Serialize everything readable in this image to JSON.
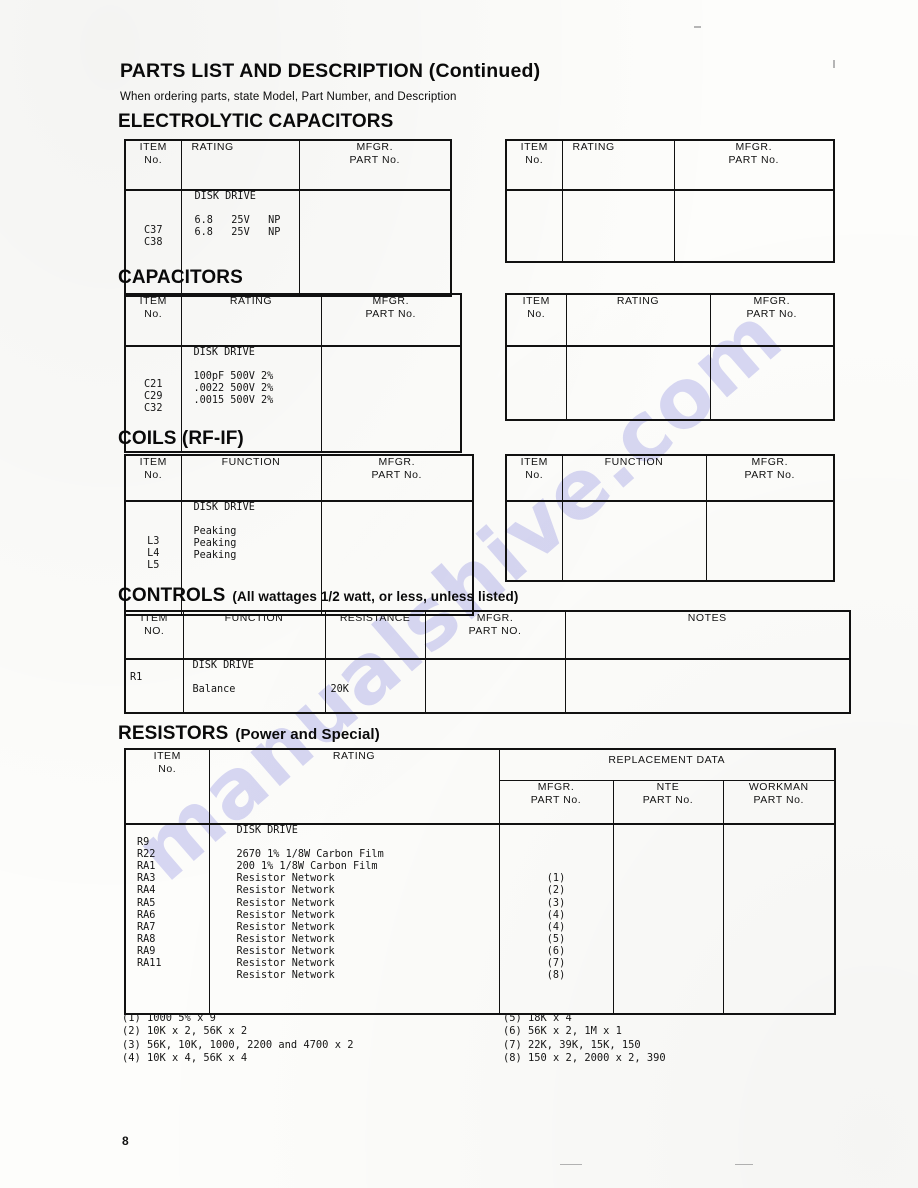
{
  "document": {
    "title": "PARTS LIST AND DESCRIPTION (Continued)",
    "subtitle": "When ordering parts, state Model, Part Number, and Description",
    "page_number": "8",
    "watermark": "manualshive.com"
  },
  "sections": [
    {
      "id": "electrolytic-capacitors",
      "heading": "ELECTROLYTIC CAPACITORS",
      "heading_qualifier": "",
      "left_table": {
        "headers": [
          "ITEM\nNo.",
          "RATING",
          "MFGR.\nPART No."
        ],
        "group_label": "DISK DRIVE",
        "rows": [
          {
            "item": "C37",
            "rating": "6.8   25V   NP",
            "mfgr": ""
          },
          {
            "item": "C38",
            "rating": "6.8   25V   NP",
            "mfgr": ""
          }
        ]
      },
      "right_table": {
        "headers": [
          "ITEM\nNo.",
          "RATING",
          "MFGR.\nPART No."
        ],
        "rows": []
      }
    },
    {
      "id": "capacitors",
      "heading": "CAPACITORS",
      "heading_qualifier": "",
      "left_table": {
        "headers": [
          "ITEM\nNo.",
          "RATING",
          "MFGR.\nPART No."
        ],
        "group_label": "DISK DRIVE",
        "rows": [
          {
            "item": "C21",
            "rating": "100pF 500V 2%",
            "mfgr": ""
          },
          {
            "item": "C29",
            "rating": ".0022 500V 2%",
            "mfgr": ""
          },
          {
            "item": "C32",
            "rating": ".0015 500V 2%",
            "mfgr": ""
          }
        ]
      },
      "right_table": {
        "headers": [
          "ITEM\nNo.",
          "RATING",
          "MFGR.\nPART No."
        ],
        "rows": []
      }
    },
    {
      "id": "coils-rf-if",
      "heading": "COILS (RF-IF)",
      "heading_qualifier": "",
      "left_table": {
        "headers": [
          "ITEM\nNo.",
          "FUNCTION",
          "MFGR.\nPART No."
        ],
        "group_label": "DISK DRIVE",
        "rows": [
          {
            "item": "L3",
            "rating": "Peaking",
            "mfgr": ""
          },
          {
            "item": "L4",
            "rating": "Peaking",
            "mfgr": ""
          },
          {
            "item": "L5",
            "rating": "Peaking",
            "mfgr": ""
          }
        ]
      },
      "right_table": {
        "headers": [
          "ITEM\nNo.",
          "FUNCTION",
          "MFGR.\nPART No."
        ],
        "rows": []
      }
    }
  ],
  "controls": {
    "heading": "CONTROLS",
    "heading_qualifier": "(All wattages 1/2 watt, or less, unless listed)",
    "headers": [
      "ITEM\nNO.",
      "FUNCTION",
      "RESISTANCE",
      "MFGR.\nPART NO.",
      "NOTES"
    ],
    "group_label": "DISK DRIVE",
    "rows": [
      {
        "item": "R1",
        "function": "Balance",
        "resistance": "20K",
        "mfgr": "",
        "notes": ""
      }
    ]
  },
  "resistors": {
    "heading": "RESISTORS",
    "heading_qualifier": "(Power and Special)",
    "group_header": "REPLACEMENT DATA",
    "headers": [
      "ITEM\nNo.",
      "RATING",
      "MFGR.\nPART No.",
      "NTE\nPART No.",
      "WORKMAN\nPART No."
    ],
    "group_label": "DISK DRIVE",
    "rows": [
      {
        "item": "R9",
        "rating": "2670 1% 1/8W Carbon Film",
        "mfgr": "",
        "nte": "",
        "workman": ""
      },
      {
        "item": "R22",
        "rating": "200 1% 1/8W Carbon Film",
        "mfgr": "",
        "nte": "",
        "workman": ""
      },
      {
        "item": "RA1",
        "rating": "Resistor Network",
        "mfgr": "(1)",
        "nte": "",
        "workman": ""
      },
      {
        "item": "RA3",
        "rating": "Resistor Network",
        "mfgr": "(2)",
        "nte": "",
        "workman": ""
      },
      {
        "item": "RA4",
        "rating": "Resistor Network",
        "mfgr": "(3)",
        "nte": "",
        "workman": ""
      },
      {
        "item": "RA5",
        "rating": "Resistor Network",
        "mfgr": "(4)",
        "nte": "",
        "workman": ""
      },
      {
        "item": "RA6",
        "rating": "Resistor Network",
        "mfgr": "(4)",
        "nte": "",
        "workman": ""
      },
      {
        "item": "RA7",
        "rating": "Resistor Network",
        "mfgr": "(5)",
        "nte": "",
        "workman": ""
      },
      {
        "item": "RA8",
        "rating": "Resistor Network",
        "mfgr": "(6)",
        "nte": "",
        "workman": ""
      },
      {
        "item": "RA9",
        "rating": "Resistor Network",
        "mfgr": "(7)",
        "nte": "",
        "workman": ""
      },
      {
        "item": "RA11",
        "rating": "Resistor Network",
        "mfgr": "(8)",
        "nte": "",
        "workman": ""
      }
    ]
  },
  "footnotes": {
    "left": "(1) 1000 5% x 9\n(2) 10K x 2, 56K x 2\n(3) 56K, 10K, 1000, 2200 and 4700 x 2\n(4) 10K x 4, 56K x 4",
    "right": "(5) 18K x 4\n(6) 56K x 2, 1M x 1\n(7) 22K, 39K, 15K, 150\n(8) 150 x 2, 2000 x 2, 390"
  },
  "derived": {
    "elec_left_item_col": "C37\nC38",
    "elec_left_rating_col": "DISK DRIVE\n\n6.8   25V   NP\n6.8   25V   NP",
    "cap_left_item_col": "C21\nC29\nC32",
    "cap_left_rating_col": "DISK DRIVE\n\n100pF 500V 2%\n.0022 500V 2%\n.0015 500V 2%",
    "coil_left_item_col": "L3\nL4\nL5",
    "coil_left_rating_col": "DISK DRIVE\n\nPeaking\nPeaking\nPeaking",
    "controls_item_col": "\nR1",
    "controls_function_col": "DISK DRIVE\n\nBalance",
    "controls_resistance_col": "\n\n20K",
    "res_item_col": "\nR9\nR22\nRA1\nRA3\nRA4\nRA5\nRA6\nRA7\nRA8\nRA9\nRA11",
    "res_rating_col": "DISK DRIVE\n\n2670 1% 1/8W Carbon Film\n200 1% 1/8W Carbon Film\nResistor Network\nResistor Network\nResistor Network\nResistor Network\nResistor Network\nResistor Network\nResistor Network\nResistor Network\nResistor Network",
    "res_mfgr_col": "\n\n\n\n(1)\n(2)\n(3)\n(4)\n(4)\n(5)\n(6)\n(7)\n(8)"
  }
}
